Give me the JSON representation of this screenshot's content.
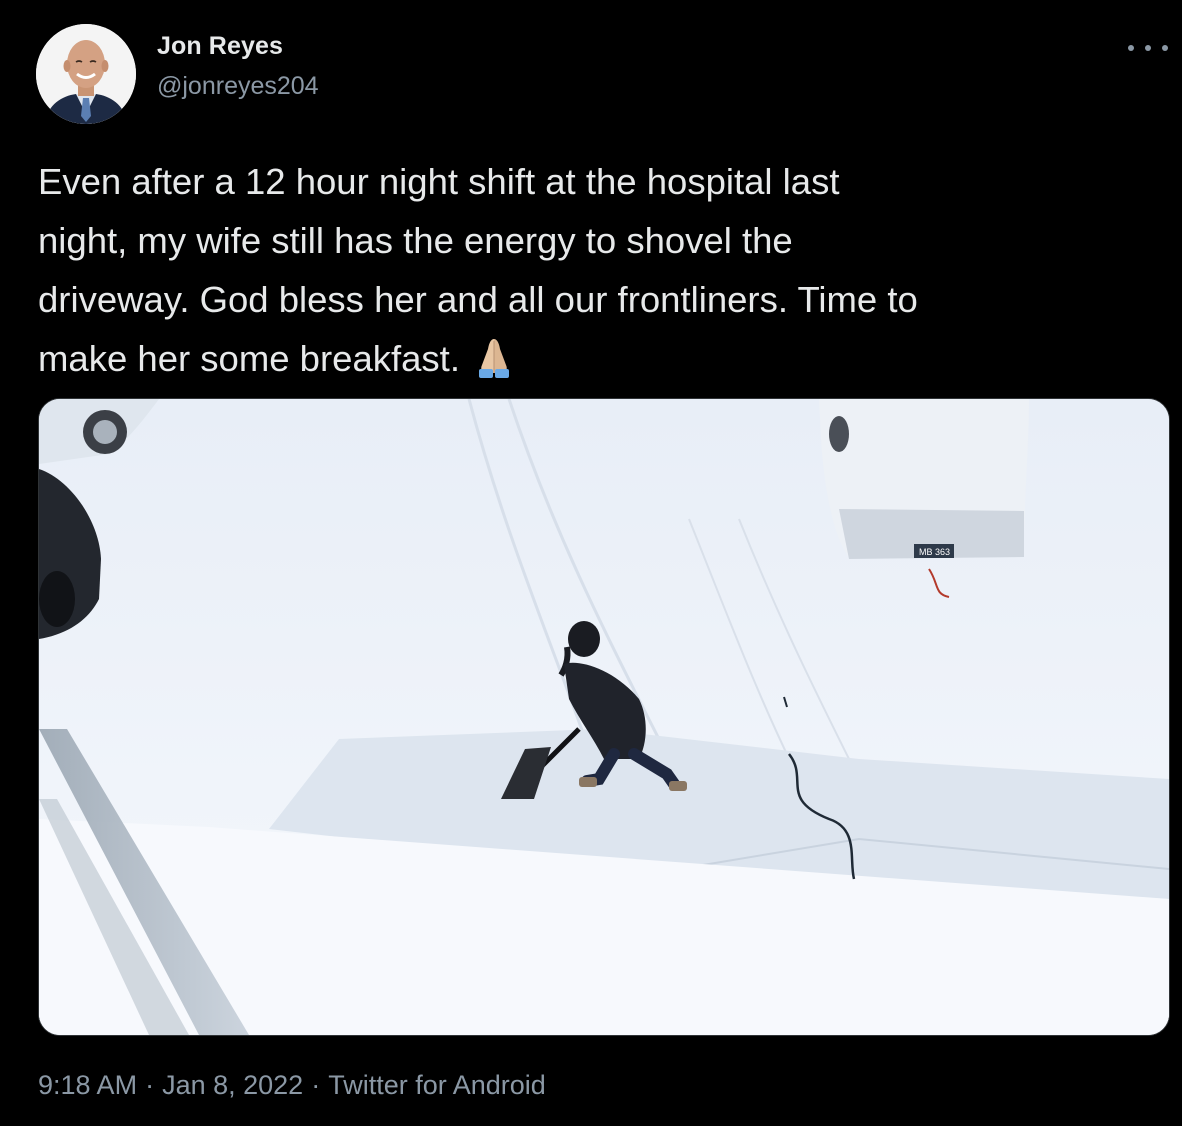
{
  "tweet": {
    "author": {
      "name": "Jon Reyes",
      "handle": "@jonreyes204",
      "avatar_icon": "person-avatar-icon"
    },
    "more_icon": "ellipsis-icon",
    "text": "Even after a 12 hour night shift at the hospital last\nnight, my wife still has the energy to shovel the\ndriveway. God bless her and all our frontliners. Time to\nmake her some breakfast.",
    "emoji_icon": "folded-hands-icon",
    "media": {
      "kind": "photo",
      "plate_text": "MB 363"
    },
    "meta": {
      "time": "9:18 AM",
      "date": "Jan 8, 2022",
      "source": "Twitter for Android",
      "separator": "·"
    }
  },
  "colors": {
    "background": "#000000",
    "primary_text": "#e7e9ea",
    "secondary_text": "#8b98a5"
  }
}
